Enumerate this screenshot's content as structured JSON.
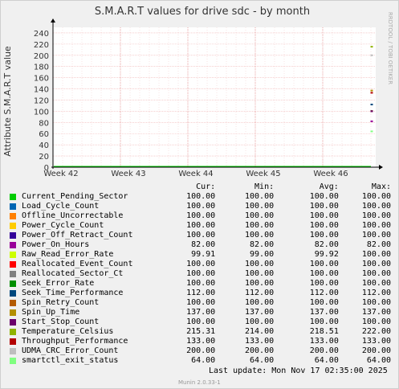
{
  "chart_data": {
    "type": "line",
    "title": "S.M.A.R.T values for drive sdc - by month",
    "ylabel": "Attribute S.M.A.R.T value",
    "side_text": "RRDTOOL / TOBI OETIKER",
    "ylim": [
      0,
      250
    ],
    "yticks": [
      "0",
      "20",
      "40",
      "60",
      "80",
      "100",
      "120",
      "140",
      "160",
      "180",
      "200",
      "220",
      "240"
    ],
    "ytick_values": [
      0,
      20,
      40,
      60,
      80,
      100,
      120,
      140,
      160,
      180,
      200,
      220,
      240
    ],
    "xtick_labels": [
      "Week 42",
      "Week 43",
      "Week 44",
      "Week 45",
      "Week 46"
    ],
    "grid": true,
    "legend_headers": {
      "cur": "Cur:",
      "min": "Min:",
      "avg": "Avg:",
      "max": "Max:"
    },
    "series": [
      {
        "name": "Current_Pending_Sector",
        "color": "#00cc00",
        "cur": "100.00",
        "min": "100.00",
        "avg": "100.00",
        "max": "100.00",
        "value": 100
      },
      {
        "name": "Load_Cycle_Count",
        "color": "#0066b3",
        "cur": "100.00",
        "min": "100.00",
        "avg": "100.00",
        "max": "100.00",
        "value": 100
      },
      {
        "name": "Offline_Uncorrectable",
        "color": "#ff8000",
        "cur": "100.00",
        "min": "100.00",
        "avg": "100.00",
        "max": "100.00",
        "value": 100
      },
      {
        "name": "Power_Cycle_Count",
        "color": "#ffcc00",
        "cur": "100.00",
        "min": "100.00",
        "avg": "100.00",
        "max": "100.00",
        "value": 100
      },
      {
        "name": "Power_Off_Retract_Count",
        "color": "#330099",
        "cur": "100.00",
        "min": "100.00",
        "avg": "100.00",
        "max": "100.00",
        "value": 100
      },
      {
        "name": "Power_On_Hours",
        "color": "#990099",
        "cur": "82.00",
        "min": "82.00",
        "avg": "82.00",
        "max": "82.00",
        "value": 82
      },
      {
        "name": "Raw_Read_Error_Rate",
        "color": "#ccff00",
        "cur": "99.91",
        "min": "99.00",
        "avg": "99.92",
        "max": "100.00",
        "value": 99.91
      },
      {
        "name": "Reallocated_Event_Count",
        "color": "#ff0000",
        "cur": "100.00",
        "min": "100.00",
        "avg": "100.00",
        "max": "100.00",
        "value": 100
      },
      {
        "name": "Reallocated_Sector_Ct",
        "color": "#808080",
        "cur": "100.00",
        "min": "100.00",
        "avg": "100.00",
        "max": "100.00",
        "value": 100
      },
      {
        "name": "Seek_Error_Rate",
        "color": "#008f00",
        "cur": "100.00",
        "min": "100.00",
        "avg": "100.00",
        "max": "100.00",
        "value": 100
      },
      {
        "name": "Seek_Time_Performance",
        "color": "#00487d",
        "cur": "112.00",
        "min": "112.00",
        "avg": "112.00",
        "max": "112.00",
        "value": 112
      },
      {
        "name": "Spin_Retry_Count",
        "color": "#b35a00",
        "cur": "100.00",
        "min": "100.00",
        "avg": "100.00",
        "max": "100.00",
        "value": 100
      },
      {
        "name": "Spin_Up_Time",
        "color": "#b38f00",
        "cur": "137.00",
        "min": "137.00",
        "avg": "137.00",
        "max": "137.00",
        "value": 137
      },
      {
        "name": "Start_Stop_Count",
        "color": "#6b006b",
        "cur": "100.00",
        "min": "100.00",
        "avg": "100.00",
        "max": "100.00",
        "value": 100
      },
      {
        "name": "Temperature_Celsius",
        "color": "#8fb300",
        "cur": "215.31",
        "min": "214.00",
        "avg": "218.51",
        "max": "222.00",
        "value": 215.31
      },
      {
        "name": "Throughput_Performance",
        "color": "#b30000",
        "cur": "133.00",
        "min": "133.00",
        "avg": "133.00",
        "max": "133.00",
        "value": 133
      },
      {
        "name": "UDMA_CRC_Error_Count",
        "color": "#bebebe",
        "cur": "200.00",
        "min": "200.00",
        "avg": "200.00",
        "max": "200.00",
        "value": 200
      },
      {
        "name": "smartctl_exit_status",
        "color": "#80ff80",
        "cur": "64.00",
        "min": "64.00",
        "avg": "64.00",
        "max": "64.00",
        "value": 64
      }
    ]
  },
  "footer": {
    "last_update": "Last update:  Mon Nov 17 02:35:00 2025",
    "generator": "Munin 2.0.33-1"
  }
}
